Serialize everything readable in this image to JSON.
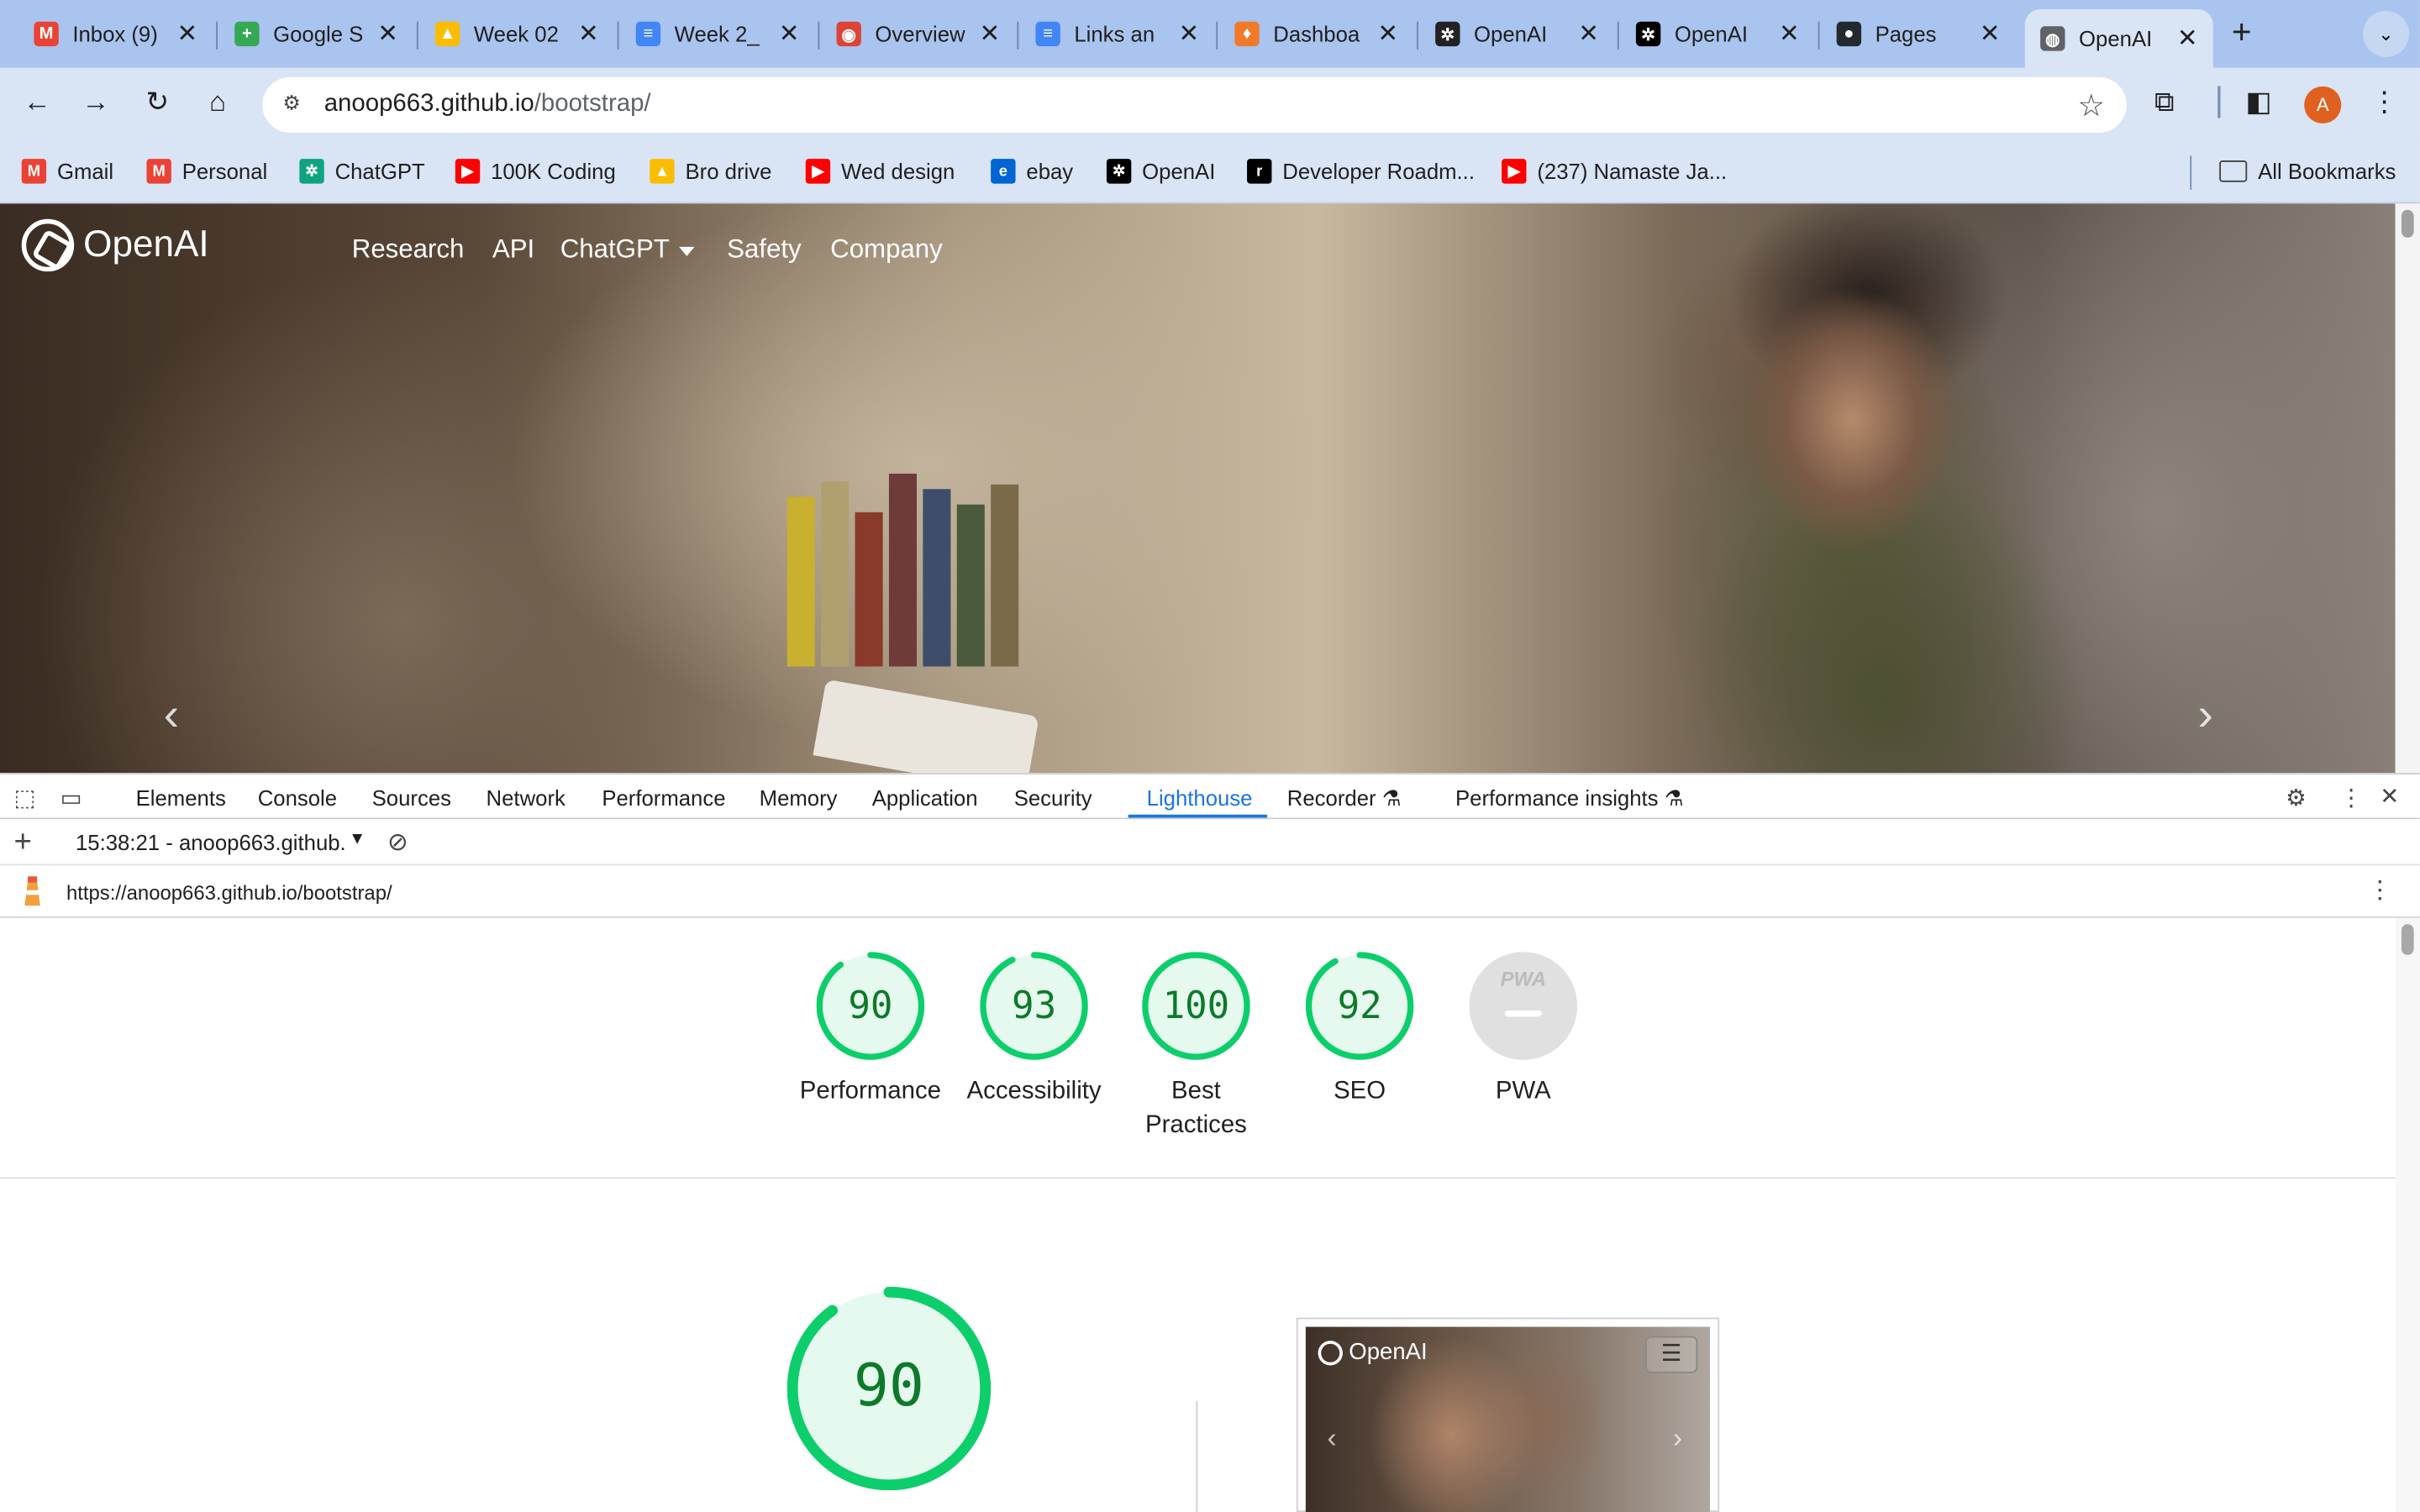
{
  "browser": {
    "tabs": [
      {
        "title": "Inbox (9)",
        "icon": "gmail-icon",
        "color": "#ea4335",
        "glyph": "M"
      },
      {
        "title": "Google S",
        "icon": "google-sheets-icon",
        "color": "#34a853",
        "glyph": "+"
      },
      {
        "title": "Week 02",
        "icon": "google-drive-icon",
        "color": "#fbbc04",
        "glyph": "▲"
      },
      {
        "title": "Week 2_",
        "icon": "google-docs-icon",
        "color": "#4285f4",
        "glyph": "≡"
      },
      {
        "title": "Overview",
        "icon": "chrome-icon",
        "color": "#db4437",
        "glyph": "◉"
      },
      {
        "title": "Links an",
        "icon": "google-docs-icon",
        "color": "#4285f4",
        "glyph": "≡"
      },
      {
        "title": "Dashboa",
        "icon": "dashboard-icon",
        "color": "#f07a2a",
        "glyph": "♦"
      },
      {
        "title": "OpenAI",
        "icon": "openai-icon",
        "color": "#222222",
        "glyph": "✲"
      },
      {
        "title": "OpenAI",
        "icon": "openai-icon",
        "color": "#000000",
        "glyph": "✲"
      },
      {
        "title": "Pages",
        "icon": "github-icon",
        "color": "#24292f",
        "glyph": "●"
      },
      {
        "title": "OpenAI",
        "icon": "globe-icon",
        "color": "#5f6368",
        "glyph": "◍",
        "active": true
      }
    ],
    "new_tab_glyph": "+",
    "tab_search_glyph": "⌄",
    "close_glyph": "✕",
    "url_host": "anoop663.github.io",
    "url_path": "/bootstrap/",
    "profile_initial": "A"
  },
  "bookmarks": [
    {
      "label": "Gmail",
      "icon": "gmail-icon",
      "color": "#ea4335",
      "glyph": "M"
    },
    {
      "label": "Personal",
      "icon": "gmail-icon",
      "color": "#ea4335",
      "glyph": "M"
    },
    {
      "label": "ChatGPT",
      "icon": "chatgpt-icon",
      "color": "#10a37f",
      "glyph": "✲"
    },
    {
      "label": "100K Coding",
      "icon": "youtube-icon",
      "color": "#ff0000",
      "glyph": "▶"
    },
    {
      "label": "Bro drive",
      "icon": "google-drive-icon",
      "color": "#fbbc04",
      "glyph": "▲"
    },
    {
      "label": "Wed design",
      "icon": "youtube-icon",
      "color": "#ff0000",
      "glyph": "▶"
    },
    {
      "label": "ebay",
      "icon": "ebay-icon",
      "color": "#0064d2",
      "glyph": "e"
    },
    {
      "label": "OpenAI",
      "icon": "openai-icon",
      "color": "#000000",
      "glyph": "✲"
    },
    {
      "label": "Developer Roadm...",
      "icon": "roadmap-icon",
      "color": "#000000",
      "glyph": "r"
    },
    {
      "label": "(237) Namaste Ja...",
      "icon": "youtube-icon",
      "color": "#ff0000",
      "glyph": "▶"
    }
  ],
  "all_bookmarks_label": "All Bookmarks",
  "site": {
    "logo_text": "OpenAI",
    "nav": [
      "Research",
      "API",
      "ChatGPT",
      "Safety",
      "Company"
    ]
  },
  "devtools": {
    "tabs": [
      "Elements",
      "Console",
      "Sources",
      "Network",
      "Performance",
      "Memory",
      "Application",
      "Security",
      "Lighthouse",
      "Recorder",
      "Performance insights"
    ],
    "active_tab": "Lighthouse",
    "report_selector": "15:38:21 - anoop663.github.io",
    "report_url": "https://anoop663.github.io/bootstrap/",
    "scores": [
      {
        "label": "Performance",
        "value": "90",
        "score": 90
      },
      {
        "label": "Accessibility",
        "value": "93",
        "score": 93
      },
      {
        "label": "Best Practices",
        "value": "100",
        "score": 100
      },
      {
        "label": "SEO",
        "value": "92",
        "score": 92
      },
      {
        "label": "PWA",
        "value": "PWA",
        "score": null
      }
    ],
    "big_score": {
      "value": "90",
      "score": 90
    },
    "thumbnail_logo": "OpenAI",
    "pass_color": "#0cce6b"
  }
}
